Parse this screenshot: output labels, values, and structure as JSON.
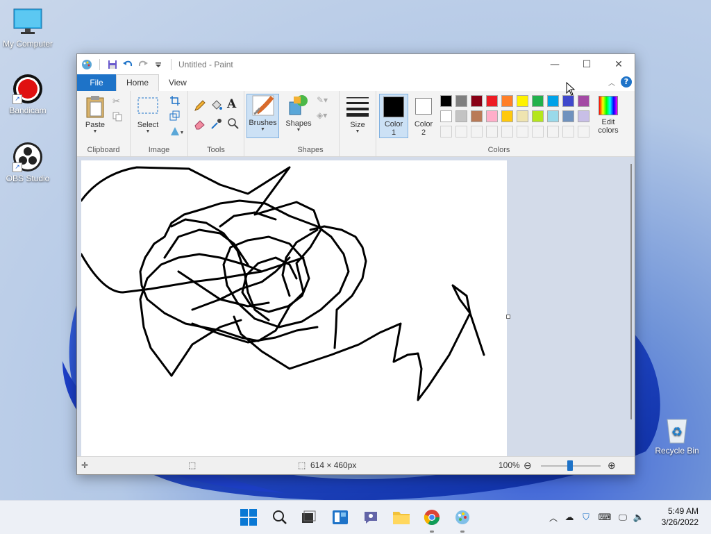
{
  "desktop": {
    "icons": [
      {
        "label": "My Computer"
      },
      {
        "label": "Bandicam"
      },
      {
        "label": "OBS Studio"
      },
      {
        "label": "Recycle Bin"
      }
    ]
  },
  "window": {
    "title": "Untitled - Paint",
    "controls": {
      "minimize": "—",
      "maximize": "☐",
      "close": "✕"
    }
  },
  "tabs": [
    {
      "label": "File"
    },
    {
      "label": "Home"
    },
    {
      "label": "View"
    }
  ],
  "ribbon": {
    "clipboard": {
      "group": "Clipboard",
      "paste": "Paste"
    },
    "image": {
      "group": "Image",
      "select": "Select"
    },
    "tools": {
      "group": "Tools"
    },
    "brushes": {
      "label": "Brushes"
    },
    "shapes": {
      "group": "Shapes",
      "shapes": "Shapes"
    },
    "size": {
      "label": "Size"
    },
    "colors": {
      "group": "Colors",
      "color1": {
        "line1": "Color",
        "line2": "1",
        "value": "#000000"
      },
      "color2": {
        "line1": "Color",
        "line2": "2",
        "value": "#ffffff"
      },
      "edit_line1": "Edit",
      "edit_line2": "colors",
      "row1": [
        "#000000",
        "#7f7f7f",
        "#880015",
        "#ed1c24",
        "#ff7f27",
        "#fff200",
        "#22b14c",
        "#00a2e8",
        "#3f48cc",
        "#a349a4"
      ],
      "row2": [
        "#ffffff",
        "#c3c3c3",
        "#b97a57",
        "#ffaec9",
        "#ffc90e",
        "#efe4b0",
        "#b5e61d",
        "#99d9ea",
        "#7092be",
        "#c8bfe7"
      ],
      "row3": [
        "#f3f3f3",
        "#f3f3f3",
        "#f3f3f3",
        "#f3f3f3",
        "#f3f3f3",
        "#f3f3f3",
        "#f3f3f3",
        "#f3f3f3",
        "#f3f3f3",
        "#f3f3f3"
      ]
    }
  },
  "status": {
    "canvas_size": "614 × 460px",
    "zoom": "100%"
  },
  "taskbar": {
    "time": "5:49 AM",
    "date": "3/26/2022"
  }
}
